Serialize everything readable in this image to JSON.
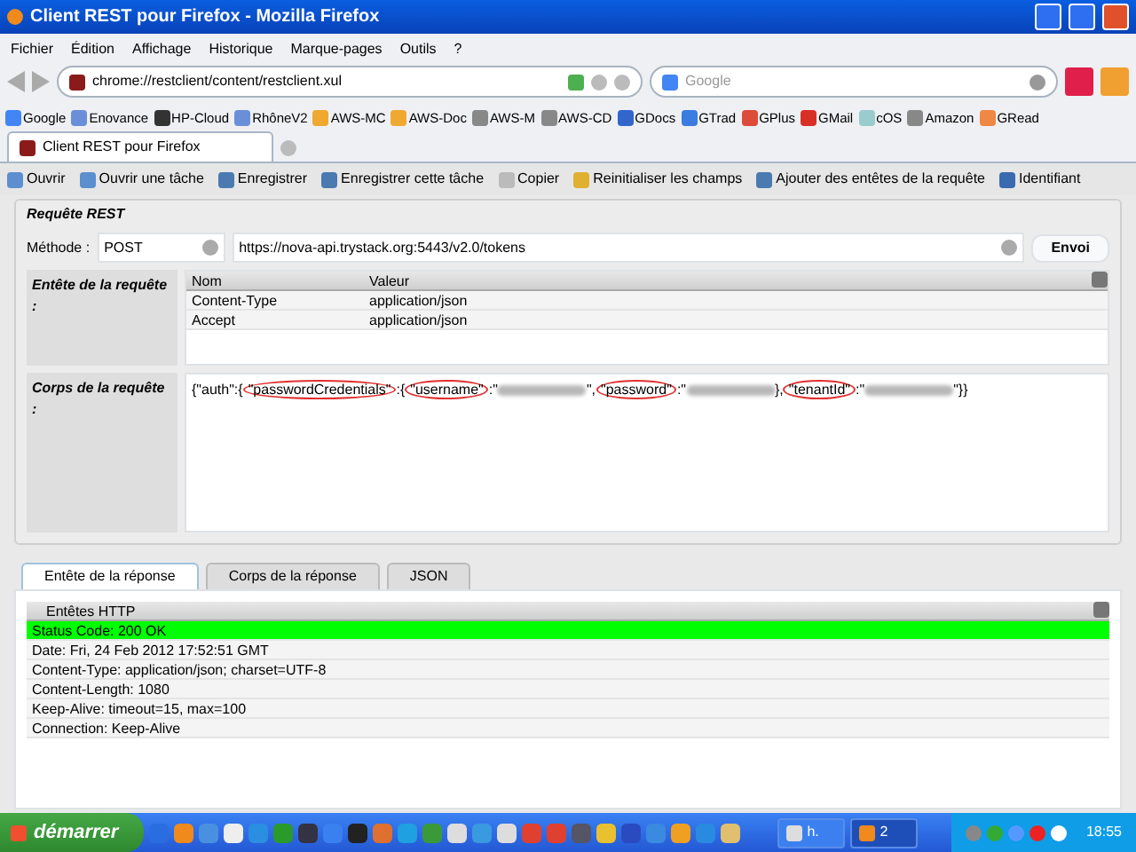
{
  "window": {
    "title": "Client REST pour Firefox - Mozilla Firefox"
  },
  "menu": [
    "Fichier",
    "Édition",
    "Affichage",
    "Historique",
    "Marque-pages",
    "Outils",
    "?"
  ],
  "address": {
    "value": "chrome://restclient/content/restclient.xul"
  },
  "search": {
    "placeholder": "Google"
  },
  "bookmarks": [
    "Google",
    "Enovance",
    "HP-Cloud",
    "RhôneV2",
    "AWS-MC",
    "AWS-Doc",
    "AWS-M",
    "AWS-CD",
    "GDocs",
    "GTrad",
    "GPlus",
    "GMail",
    "cOS",
    "Amazon",
    "GRead"
  ],
  "browser_tabs": [
    {
      "label": "Client REST pour Firefox",
      "selected": true
    }
  ],
  "toolbar": [
    "Ouvrir",
    "Ouvrir une tâche",
    "Enregistrer",
    "Enregistrer cette tâche",
    "Copier",
    "Reinitialiser les champs",
    "Ajouter des entêtes de la requête",
    "Identifiant"
  ],
  "request": {
    "title": "Requête REST",
    "method_label": "Méthode :",
    "method": "POST",
    "url": "https://nova-api.trystack.org:5443/v2.0/tokens",
    "send": "Envoi",
    "headers_label": "Entête de la requête :",
    "columns": [
      "Nom",
      "Valeur"
    ],
    "headers": [
      [
        "Content-Type",
        "application/json"
      ],
      [
        "Accept",
        "application/json"
      ]
    ],
    "body_label": "Corps de la requête :",
    "body": [
      {
        "kind": "text",
        "text": "{\"auth\":{"
      },
      {
        "kind": "circled",
        "text": "\"passwordCredentials\""
      },
      {
        "kind": "text",
        "text": ":{"
      },
      {
        "kind": "circled",
        "text": "\"username\""
      },
      {
        "kind": "text",
        "text": ":\""
      },
      {
        "kind": "blur"
      },
      {
        "kind": "text",
        "text": "\","
      },
      {
        "kind": "circled",
        "text": "\"password\""
      },
      {
        "kind": "text",
        "text": ":\""
      },
      {
        "kind": "blur"
      },
      {
        "kind": "text",
        "text": "},"
      },
      {
        "kind": "circled",
        "text": "\"tenantId\""
      },
      {
        "kind": "text",
        "text": ":\""
      },
      {
        "kind": "blur"
      },
      {
        "kind": "text",
        "text": "\"}}"
      }
    ]
  },
  "response_tabs": [
    {
      "label": "Entête de la réponse",
      "selected": true
    },
    {
      "label": "Corps de la réponse",
      "selected": false
    },
    {
      "label": "JSON",
      "selected": false
    }
  ],
  "response": {
    "column": "Entêtes HTTP",
    "rows": [
      {
        "text": "Status Code: 200 OK",
        "color": "#00ff00"
      },
      {
        "text": "Date: Fri, 24 Feb 2012 17:52:51 GMT"
      },
      {
        "text": "Content-Type: application/json; charset=UTF-8"
      },
      {
        "text": "Content-Length: 1080"
      },
      {
        "text": "Keep-Alive: timeout=15, max=100"
      },
      {
        "text": "Connection: Keep-Alive"
      }
    ]
  },
  "taskbar": {
    "start": "démarrer",
    "tasks": [
      {
        "label": "h.",
        "selected": false
      },
      {
        "label": "2",
        "selected": true
      }
    ],
    "clock": "18:55"
  }
}
